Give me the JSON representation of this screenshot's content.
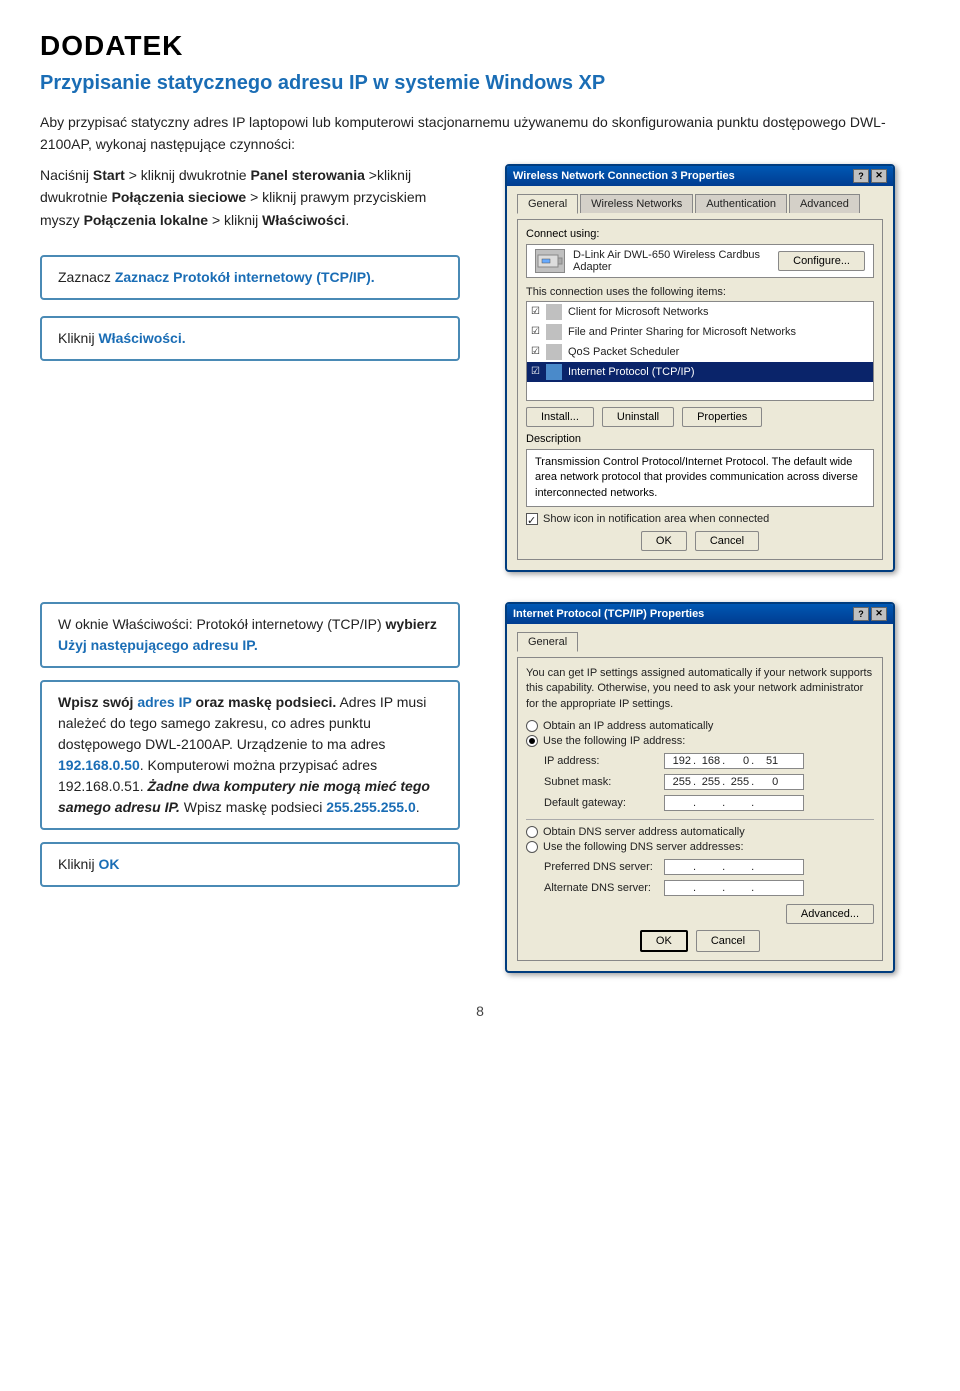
{
  "page": {
    "heading": "DODATEK",
    "section_title": "Przypisanie statycznego adresu IP w systemie Windows XP",
    "intro": "Aby przypisać statyczny adres IP laptopowi lub komputerowi stacjonarnemu używanemu do skonfigurowania punktu dostępowego DWL-2100AP, wykonaj następujące czynności:",
    "step1": "Naciśnij Start > kliknij dwukrotnie Panel sterowania >kliknij dwukrotnie Połączenia sieciowe > kliknij prawym przyciskiem myszy Połączenia lokalne > kliknij Właściwości.",
    "highlight1": "Zaznacz Protokół internetowy (TCP/IP).",
    "highlight2": "Kliknij Właściwości.",
    "bottom_text1": "W oknie Właściwości: Protokół internetowy (TCP/IP) wybierz Użyj następującego adresu IP.",
    "bottom_text2_pre": "Wpisz swój ",
    "bottom_text2_highlight": "adres IP",
    "bottom_text2_mid": " oraz ",
    "bottom_text2_bold": "maskę podsieci.",
    "bottom_text2_rest": " Adres IP musi należeć do tego samego zakresu, co adres punktu dostępowego DWL-2100AP. Urządzenie to ma adres ",
    "bottom_text2_ip": "192.168.0.50",
    "bottom_text2_rest2": ". Komputerowi można przypisać adres 192.168.0.51. ",
    "bottom_text2_italic_bold": "Żadne dwa komputery nie mogą mieć tego samego adresu IP.",
    "bottom_text2_rest3": " Wpisz maskę podsieci ",
    "bottom_text2_subnet": "255.255.255.0",
    "bottom_text2_end": ".",
    "highlight3": "Kliknij OK",
    "page_number": "8"
  },
  "dialog1": {
    "title": "Wireless Network Connection 3 Properties",
    "tabs": [
      "General",
      "Wireless Networks",
      "Authentication",
      "Advanced"
    ],
    "connect_using_label": "Connect using:",
    "adapter_name": "D-Link Air DWL-650 Wireless Cardbus Adapter",
    "configure_btn": "Configure...",
    "items_label": "This connection uses the following items:",
    "items": [
      {
        "checked": true,
        "name": "Client for Microsoft Networks"
      },
      {
        "checked": true,
        "name": "File and Printer Sharing for Microsoft Networks"
      },
      {
        "checked": true,
        "name": "QoS Packet Scheduler"
      },
      {
        "checked": true,
        "name": "Internet Protocol (TCP/IP)",
        "selected": true
      }
    ],
    "install_btn": "Install...",
    "uninstall_btn": "Uninstall",
    "properties_btn": "Properties",
    "description_label": "Description",
    "description_text": "Transmission Control Protocol/Internet Protocol. The default wide area network protocol that provides communication across diverse interconnected networks.",
    "show_icon_text": "Show icon in notification area when connected",
    "ok_btn": "OK",
    "cancel_btn": "Cancel"
  },
  "dialog2": {
    "title": "Internet Protocol (TCP/IP) Properties",
    "tab": "General",
    "desc_text": "You can get IP settings assigned automatically if your network supports this capability. Otherwise, you need to ask your network administrator for the appropriate IP settings.",
    "radio1": "Obtain an IP address automatically",
    "radio2": "Use the following IP address:",
    "ip_address_label": "IP address:",
    "ip_address": {
      "a": "192",
      "b": "168",
      "c": "0",
      "d": "51"
    },
    "subnet_mask_label": "Subnet mask:",
    "subnet_mask": {
      "a": "255",
      "b": "255",
      "c": "255",
      "d": "0"
    },
    "gateway_label": "Default gateway:",
    "gateway": {
      "a": "",
      "b": "",
      "c": "",
      "d": ""
    },
    "radio3": "Obtain DNS server address automatically",
    "radio4": "Use the following DNS server addresses:",
    "preferred_dns_label": "Preferred DNS server:",
    "preferred_dns": {
      "a": "",
      "b": "",
      "c": "",
      "d": ""
    },
    "alternate_dns_label": "Alternate DNS server:",
    "alternate_dns": {
      "a": "",
      "b": "",
      "c": "",
      "d": ""
    },
    "advanced_btn": "Advanced...",
    "ok_btn": "OK",
    "cancel_btn": "Cancel"
  }
}
